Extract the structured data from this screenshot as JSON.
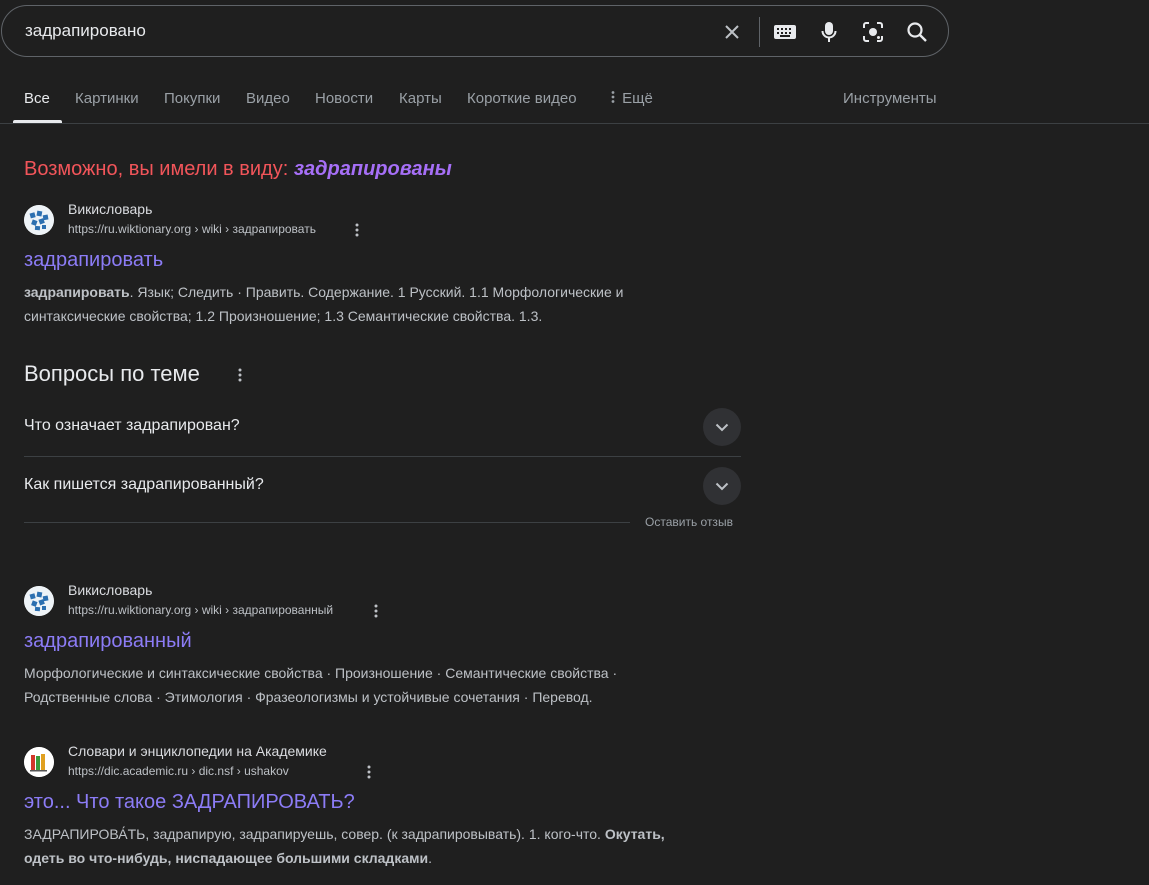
{
  "search": {
    "query": "задрапировано"
  },
  "tabs": [
    {
      "label": "Все"
    },
    {
      "label": "Картинки"
    },
    {
      "label": "Покупки"
    },
    {
      "label": "Видео"
    },
    {
      "label": "Новости"
    },
    {
      "label": "Карты"
    },
    {
      "label": "Короткие видео"
    },
    {
      "label": "Ещё"
    }
  ],
  "tools_label": "Инструменты",
  "did_you_mean": {
    "prefix": "Возможно, вы имели в виду:",
    "suggestion": "задрапированы"
  },
  "results": [
    {
      "site": "Викисловарь",
      "url": "https://ru.wiktionary.org › wiki › задрапировать",
      "title": "задрапировать",
      "snippet_bold": "задрапировать",
      "snippet_line1": ". Язык; Следить · Править. Содержание. 1 Русский. 1.1 Морфологические и",
      "snippet_line2": "синтаксические свойства; 1.2 Произношение; 1.3 Семантические свойства. 1.3."
    },
    {
      "site": "Викисловарь",
      "url": "https://ru.wiktionary.org › wiki › задрапированный",
      "title": "задрапированный",
      "snippet_line1": "Морфологические и синтаксические свойства · Произношение · Семантические свойства ·",
      "snippet_line2": "Родственные слова · Этимология · Фразеологизмы и устойчивые сочетания · Перевод."
    },
    {
      "site": "Словари и энциклопедии на Академике",
      "url": "https://dic.academic.ru › dic.nsf › ushakov",
      "title": "это... Что такое ЗАДРАПИРОВАТЬ?",
      "snippet_line1": "ЗАДРАПИРОВА́ТЬ, задрапирую, задрапируешь, совер. (к задрапировывать). 1. кого-что. ",
      "snippet_line1_bold": "Окутать,",
      "snippet_line2_bold": "одеть во что-нибудь, ниспадающее большими складками",
      "snippet_line2_end": "."
    }
  ],
  "paa": {
    "title": "Вопросы по теме",
    "questions": [
      "Что означает задрапирован?",
      "Как пишется задрапированный?"
    ],
    "feedback": "Оставить отзыв"
  },
  "colors": {
    "accent_link": "#8c7cf6",
    "did_you_mean": "#f2555a",
    "suggestion": "#a66ff7"
  }
}
